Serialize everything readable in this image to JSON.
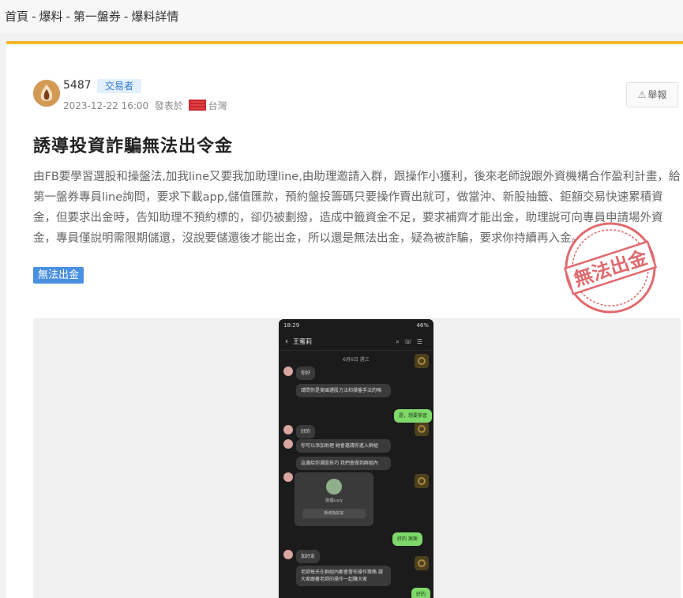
{
  "breadcrumb": {
    "items": [
      "首頁",
      "-",
      "爆料",
      "-",
      "第一盤券",
      "-",
      "爆料詳情"
    ]
  },
  "author": {
    "name": "5487",
    "role": "交易者",
    "datetime": "2023-12-22 16:00",
    "posted_in": "發表於",
    "location": "台灣"
  },
  "report_button": {
    "label": "舉報"
  },
  "post": {
    "title": "誘導投資詐騙無法出令金",
    "body": "由FB要學習選股和操盤法,加我line又要我加助理line,由助理邀請入群，跟操作小獲利，後來老師說跟外資機構合作盈利計畫，給第一盤券專員line詢問，要求下載app,儲值匯款，預約盤投籌碼只要操作賣出就可，做當沖、新股抽籤、鉅額交易快速累積資金，但要求出金時，告知助理不預約標的，卻仍被劃撥，造成中籤資金不足，要求補齊才能出金，助理說可向專員申請場外資金，專員僅說明需限期儲還，沒說要儲還後才能出金，所以還是無法出金，疑為被詐騙，要求你持續再入金。",
    "tag": "無法出金",
    "stamp_text": "無法出金"
  },
  "screenshot": {
    "status_time": "18:29",
    "status_right": "46%",
    "chat_name": "王蜜莉",
    "date_chip": "6月6日 週三",
    "messages": [
      {
        "side": "in",
        "text": "你好"
      },
      {
        "side": "in",
        "text": "請問你是美國選股方法和操盤手法的嗎"
      },
      {
        "side": "out",
        "text": "是，想要學習"
      },
      {
        "side": "in",
        "text": "好的"
      },
      {
        "side": "in",
        "text": "你可以添加助理 她會邀請你進入群組"
      },
      {
        "side": "in",
        "text": "這邊給你選股技巧 我們會做到群組內"
      },
      {
        "side": "out",
        "text": "好的 謝謝"
      },
      {
        "side": "in",
        "text": "加好友"
      },
      {
        "side": "in",
        "text": "老師每天在群組內都會發布操作策略 請大家跟著老師的操作一起賺大家"
      },
      {
        "side": "out",
        "text": "好的"
      }
    ],
    "card": {
      "name": "助理Lucy",
      "button": "新增為好友"
    }
  }
}
